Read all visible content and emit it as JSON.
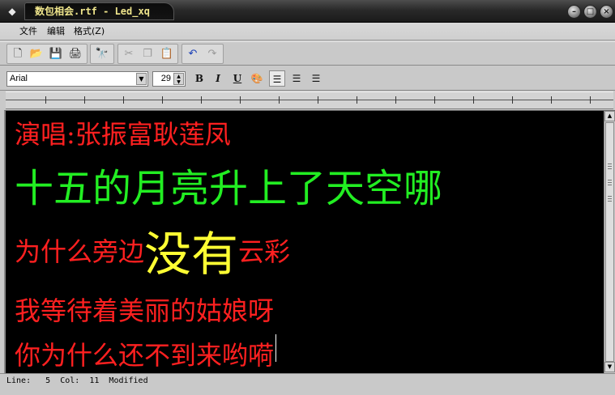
{
  "window": {
    "title": "数包相会.rtf - Led_xq",
    "icon": "app-icon",
    "controls": [
      "minimize",
      "maximize",
      "close"
    ]
  },
  "menu": {
    "file": "文件",
    "edit": "编辑",
    "format": "格式(Z)"
  },
  "toolbar": {
    "buttons": [
      {
        "name": "new-icon",
        "glyph": "🗋",
        "enabled": true
      },
      {
        "name": "open-icon",
        "glyph": "📂",
        "enabled": true
      },
      {
        "name": "save-icon",
        "glyph": "💾",
        "enabled": true
      },
      {
        "name": "print-icon",
        "glyph": "🖨",
        "enabled": true
      },
      {
        "name": "find-icon",
        "glyph": "🔭",
        "enabled": true
      },
      {
        "name": "cut-icon",
        "glyph": "✂",
        "enabled": false
      },
      {
        "name": "copy-icon",
        "glyph": "❐",
        "enabled": false
      },
      {
        "name": "paste-icon",
        "glyph": "📋",
        "enabled": true
      },
      {
        "name": "undo-icon",
        "glyph": "↶",
        "enabled": true
      },
      {
        "name": "redo-icon",
        "glyph": "↷",
        "enabled": false
      }
    ]
  },
  "format_bar": {
    "font": "Arial",
    "size": "29",
    "bold": "B",
    "italic": "I",
    "underline": "U",
    "align_left_active": true
  },
  "document": {
    "lines": [
      [
        {
          "text": "演唱:张振富耿莲凤",
          "color": "#ff2020",
          "size": "normal"
        }
      ],
      [
        {
          "text": "十五的月亮升上了天空哪",
          "color": "#22ee22",
          "size": "large"
        }
      ],
      [
        {
          "text": "为什么旁边",
          "color": "#ff2020",
          "size": "normal"
        },
        {
          "text": "没有",
          "color": "#ffff33",
          "size": "xlarge"
        },
        {
          "text": "云彩",
          "color": "#ff2020",
          "size": "normal"
        }
      ],
      [
        {
          "text": "我等待着美丽的姑娘呀",
          "color": "#ff2020",
          "size": "normal"
        }
      ],
      [
        {
          "text": "你为什么还不到来哟嗬",
          "color": "#ff2020",
          "size": "normal"
        }
      ]
    ]
  },
  "status": {
    "text": "Line:   5  Col:  11  Modified"
  }
}
